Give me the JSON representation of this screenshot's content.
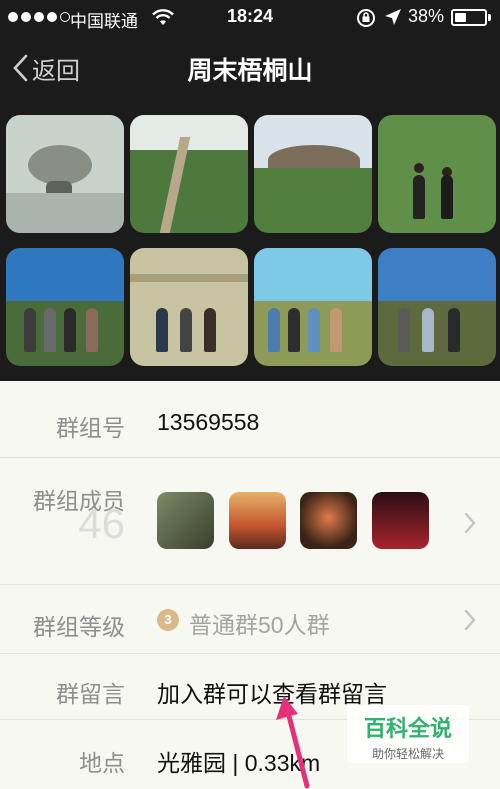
{
  "status_bar": {
    "carrier": "中国联通",
    "time": "18:24",
    "battery_percent": "38%",
    "battery_level": 0.38,
    "icons": [
      "signal-dots-icon",
      "wifi-icon",
      "rotation-lock-icon",
      "location-arrow-icon",
      "battery-icon"
    ]
  },
  "nav": {
    "back_label": "返回",
    "title": "周末梧桐山"
  },
  "photos": [
    {
      "label": "rock-in-water"
    },
    {
      "label": "mountain-path-crowd"
    },
    {
      "label": "summit-crowd"
    },
    {
      "label": "two-friends-cheering"
    },
    {
      "label": "group-on-peak"
    },
    {
      "label": "group-at-stone-rail"
    },
    {
      "label": "group-blue-sky"
    },
    {
      "label": "group-on-ridge"
    }
  ],
  "info": {
    "group_id_label": "群组号",
    "group_id_value": "13569558",
    "members_label": "群组成员",
    "member_count": "46",
    "member_avatars": [
      "avatar-1",
      "avatar-2",
      "avatar-3",
      "avatar-4"
    ],
    "level_label": "群组等级",
    "level_badge": "3",
    "level_value": "普通群50人群",
    "message_label": "群留言",
    "message_value": "加入群可以查看群留言",
    "location_label": "地点",
    "location_value": "光雅园 | 0.33km"
  },
  "watermark": {
    "title": "百科全说",
    "subtitle": "助你轻松解决"
  },
  "colors": {
    "dark_bg": "#1b1b1b",
    "panel_bg": "#f8f8f3",
    "label_gray": "#8f8f8f",
    "badge_gold": "#d9b98a",
    "annotation_pink": "#e8307a",
    "watermark_green": "#2fb36c"
  }
}
